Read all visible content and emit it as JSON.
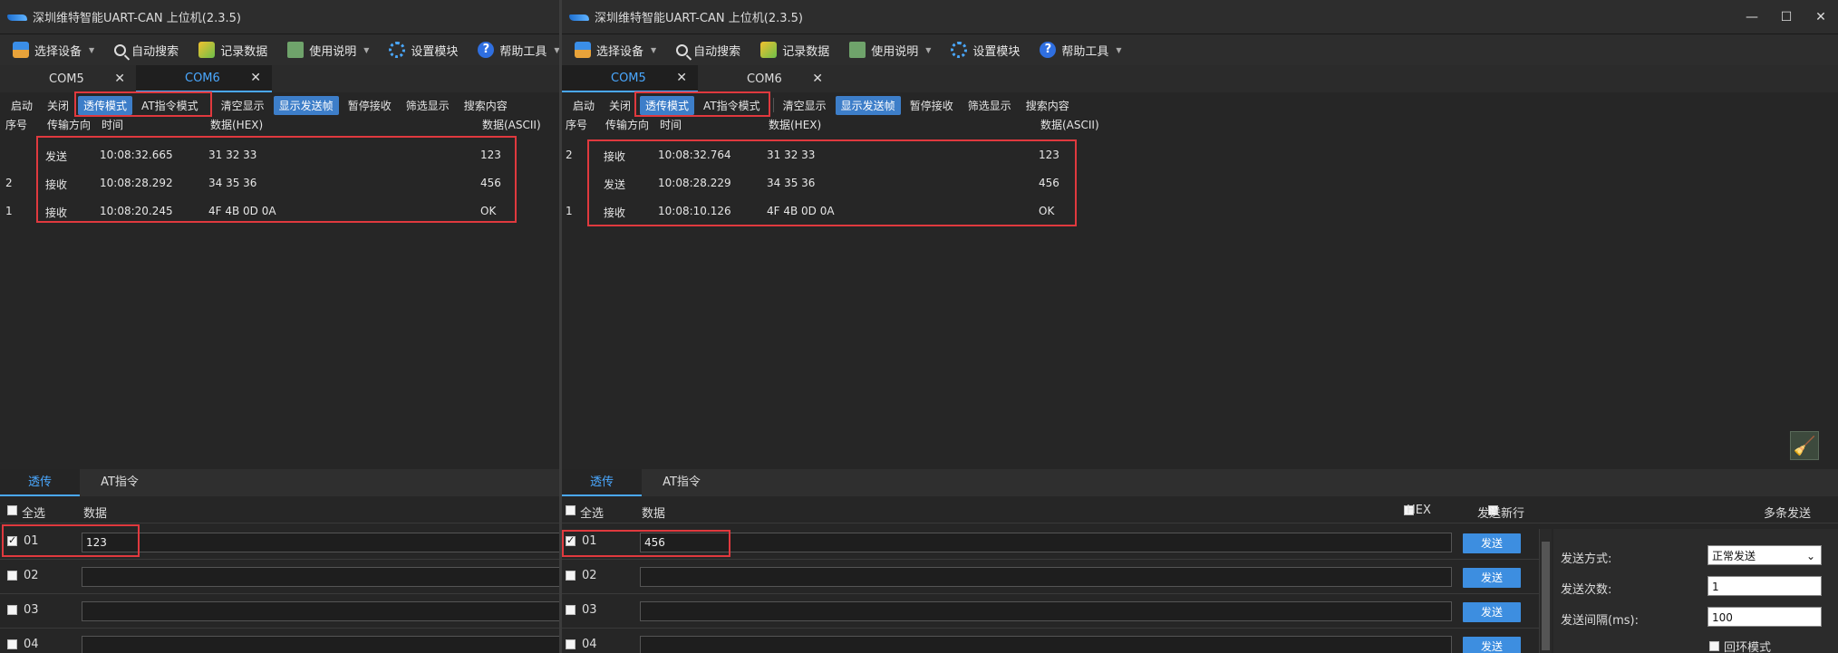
{
  "left": {
    "title": "深圳维特智能UART-CAN 上位机(2.3.5)",
    "menu": [
      "选择设备",
      "自动搜索",
      "记录数据",
      "使用说明",
      "设置模块",
      "帮助工具"
    ],
    "tabs": [
      {
        "label": "COM5",
        "active": false
      },
      {
        "label": "COM6",
        "active": true
      }
    ],
    "toolbar": [
      "启动",
      "关闭",
      "透传模式",
      "AT指令模式",
      "清空显示",
      "显示发送帧",
      "暂停接收",
      "筛选显示",
      "搜索内容"
    ],
    "columns": [
      "序号",
      "传输方向",
      "时间",
      "数据(HEX)",
      "数据(ASCII)"
    ],
    "rows": [
      {
        "idx": "",
        "dir": "发送",
        "time": "10:08:32.665",
        "hex": "31 32 33",
        "ascii": "123"
      },
      {
        "idx": "2",
        "dir": "接收",
        "time": "10:08:28.292",
        "hex": "34 35 36",
        "ascii": "456"
      },
      {
        "idx": "1",
        "dir": "接收",
        "time": "10:08:20.245",
        "hex": "4F 4B 0D 0A",
        "ascii": "OK"
      }
    ],
    "bottom_tabs": [
      "透传",
      "AT指令"
    ],
    "select_all": "全选",
    "data_col": "数据",
    "send_rows": [
      {
        "idx": "01",
        "checked": true,
        "value": "123"
      },
      {
        "idx": "02",
        "checked": false,
        "value": ""
      },
      {
        "idx": "03",
        "checked": false,
        "value": ""
      },
      {
        "idx": "04",
        "checked": false,
        "value": ""
      }
    ]
  },
  "right": {
    "title": "深圳维特智能UART-CAN 上位机(2.3.5)",
    "window_buttons": [
      "—",
      "☐",
      "✕"
    ],
    "menu": [
      "选择设备",
      "自动搜索",
      "记录数据",
      "使用说明",
      "设置模块",
      "帮助工具"
    ],
    "tabs": [
      {
        "label": "COM5",
        "active": true
      },
      {
        "label": "COM6",
        "active": false
      }
    ],
    "toolbar": [
      "启动",
      "关闭",
      "透传模式",
      "AT指令模式",
      "清空显示",
      "显示发送帧",
      "暂停接收",
      "筛选显示",
      "搜索内容"
    ],
    "columns": [
      "序号",
      "传输方向",
      "时间",
      "数据(HEX)",
      "数据(ASCII)"
    ],
    "rows": [
      {
        "idx": "2",
        "dir": "接收",
        "time": "10:08:32.764",
        "hex": "31 32 33",
        "ascii": "123"
      },
      {
        "idx": "",
        "dir": "发送",
        "time": "10:08:28.229",
        "hex": "34 35 36",
        "ascii": "456"
      },
      {
        "idx": "1",
        "dir": "接收",
        "time": "10:08:10.126",
        "hex": "4F 4B 0D 0A",
        "ascii": "OK"
      }
    ],
    "bottom_tabs": [
      "透传",
      "AT指令"
    ],
    "select_all": "全选",
    "data_col": "数据",
    "hex_label": "HEX",
    "newline_label": "发送新行",
    "multi_send": "多条发送",
    "send_label": "发送",
    "send_rows": [
      {
        "idx": "01",
        "checked": true,
        "value": "456"
      },
      {
        "idx": "02",
        "checked": false,
        "value": ""
      },
      {
        "idx": "03",
        "checked": false,
        "value": ""
      },
      {
        "idx": "04",
        "checked": false,
        "value": ""
      }
    ],
    "settings": {
      "mode_label": "发送方式:",
      "mode_value": "正常发送",
      "count_label": "发送次数:",
      "count_value": "1",
      "interval_label": "发送间隔(ms):",
      "interval_value": "100",
      "loop_label": "回环模式"
    }
  },
  "colors": {
    "accent": "#4aa8ff",
    "highlight": "#3d7ec9",
    "annotation": "#e0393e",
    "send_button": "#3d8ee0"
  }
}
